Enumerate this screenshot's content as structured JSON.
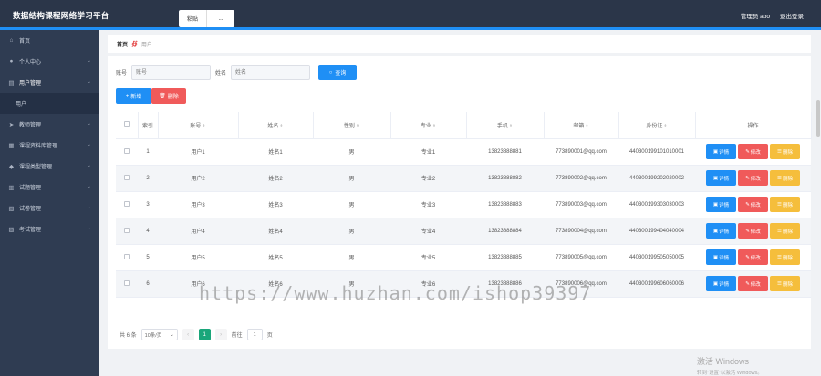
{
  "header": {
    "title": "数据结构课程网络学习平台",
    "tabs": [
      "粘贴",
      "..."
    ],
    "user_label": "管理员 abo",
    "logout": "退出登录"
  },
  "sidebar": {
    "items": [
      {
        "label": "首页",
        "icon": "home-icon",
        "glyph": "⌂",
        "chevron": false
      },
      {
        "label": "个人中心",
        "icon": "user-icon",
        "glyph": "●",
        "chevron": true
      },
      {
        "label": "用户管理",
        "icon": "users-icon",
        "glyph": "▤",
        "chevron": true
      },
      {
        "label": "用户",
        "icon": "",
        "glyph": "",
        "chevron": false,
        "sub": true
      },
      {
        "label": "教师管理",
        "icon": "send-icon",
        "glyph": "➤",
        "chevron": true
      },
      {
        "label": "课程资料库管理",
        "icon": "folder-icon",
        "glyph": "▦",
        "chevron": true
      },
      {
        "label": "课程类型管理",
        "icon": "tag-icon",
        "glyph": "◆",
        "chevron": true
      },
      {
        "label": "试题管理",
        "icon": "doc-icon",
        "glyph": "▥",
        "chevron": true
      },
      {
        "label": "试卷管理",
        "icon": "paper-icon",
        "glyph": "▧",
        "chevron": true
      },
      {
        "label": "考试管理",
        "icon": "exam-icon",
        "glyph": "▨",
        "chevron": true
      }
    ]
  },
  "breadcrumb": {
    "home": "首页",
    "current": "用户"
  },
  "search": {
    "account_label": "账号",
    "account_placeholder": "账号",
    "name_label": "姓名",
    "name_placeholder": "姓名",
    "button": "查询"
  },
  "actions": {
    "add": "新增",
    "delete": "删除"
  },
  "table": {
    "columns": [
      "索引",
      "账号",
      "姓名",
      "性别",
      "专业",
      "手机",
      "邮箱",
      "身份证",
      "操作"
    ],
    "rows": [
      [
        "1",
        "用户1",
        "姓名1",
        "男",
        "专业1",
        "13823888881",
        "773890001@qq.com",
        "440300199101010001"
      ],
      [
        "2",
        "用户2",
        "姓名2",
        "男",
        "专业2",
        "13823888882",
        "773890002@qq.com",
        "440300199202020002"
      ],
      [
        "3",
        "用户3",
        "姓名3",
        "男",
        "专业3",
        "13823888883",
        "773890003@qq.com",
        "440300199303030003"
      ],
      [
        "4",
        "用户4",
        "姓名4",
        "男",
        "专业4",
        "13823888884",
        "773890004@qq.com",
        "440300199404040004"
      ],
      [
        "5",
        "用户5",
        "姓名5",
        "男",
        "专业5",
        "13823888885",
        "773890005@qq.com",
        "440300199505050005"
      ],
      [
        "6",
        "用户6",
        "姓名6",
        "男",
        "专业6",
        "13823888886",
        "773890006@qq.com",
        "440300199606060006"
      ]
    ],
    "row_actions": {
      "detail": "详情",
      "edit": "修改",
      "remove": "删除"
    }
  },
  "pager": {
    "total": "共 6 条",
    "page_size": "10条/页",
    "current_page": "1",
    "goto_label": "前往",
    "goto_value": "1",
    "page_unit": "页"
  },
  "watermark": "https://www.huzhan.com/ishop39397",
  "windows_notice": {
    "line1": "激活 Windows",
    "line2": "转到\"设置\"以激活 Windows。"
  }
}
